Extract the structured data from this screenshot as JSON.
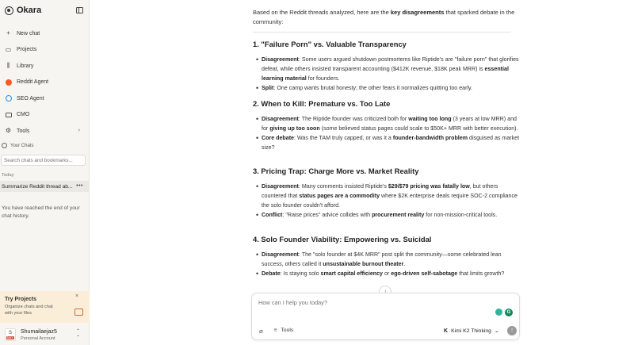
{
  "sidebar": {
    "brand": "Okara",
    "nav": [
      {
        "label": "New chat",
        "icon": "plus-icon"
      },
      {
        "label": "Projects",
        "icon": "folder-icon"
      },
      {
        "label": "Library",
        "icon": "library-icon"
      },
      {
        "label": "Reddit Agent",
        "icon": "reddit-icon"
      },
      {
        "label": "SEO Agent",
        "icon": "globe-icon"
      },
      {
        "label": "CMO",
        "icon": "cmo-icon"
      },
      {
        "label": "Tools",
        "icon": "tools-icon"
      }
    ],
    "your_chats": "Your Chats",
    "search_placeholder": "Search chats and bookmarks...",
    "today": "Today",
    "chat_item": "Summarize Reddit thread ab...",
    "end_note": "You have reached the end of your chat history.",
    "promo": {
      "title": "Try Projects",
      "desc": "Organize chats and chat with your files"
    },
    "user": {
      "initial": "S",
      "badge": "MAX",
      "name": "Shumailaejaz5",
      "sub": "Personal Account"
    }
  },
  "main": {
    "intro_pre": "Based on the Reddit threads analyzed, here are the ",
    "intro_bold": "key disagreements",
    "intro_post": " that sparked debate in the community:",
    "sections": [
      {
        "heading": "1. \"Failure Porn\" vs. Valuable Transparency"
      },
      {
        "heading": "2. When to Kill: Premature vs. Too Late"
      },
      {
        "heading": "3. Pricing Trap: Charge More vs. Market Reality"
      },
      {
        "heading": "4. Solo Founder Viability: Empowering vs. Suicidal"
      }
    ],
    "s1": {
      "b1_label": "Disagreement",
      "b1_a": ": Some users argued shutdown postmortems like Riptide's are \"failure porn\" that glorifies defeat, while others insisted transparent accounting ($412K revenue, $18K peak MRR) is ",
      "b1_bold": "essential learning material",
      "b1_b": " for founders.",
      "b2_label": "Split",
      "b2_a": ": One camp wants brutal honesty; the other fears it normalizes quitting too early."
    },
    "s2": {
      "b1_label": "Disagreement",
      "b1_a": ": The Riptide founder was criticized both for ",
      "b1_bold1": "waiting too long",
      "b1_b": " (3 years at low MRR) and for ",
      "b1_bold2": "giving up too soon",
      "b1_c": " (some believed status pages could scale to $50K+ MRR with better execution).",
      "b2_label": "Core debate",
      "b2_a": ": Was the TAM truly capped, or was it a ",
      "b2_bold": "founder-bandwidth problem",
      "b2_b": " disguised as market size?"
    },
    "s3": {
      "b1_label": "Disagreement",
      "b1_a": ": Many comments insisted Riptide's ",
      "b1_bold1": "$29/$79 pricing was fatally low",
      "b1_b": ", but others countered that ",
      "b1_bold2": "status pages are a commodity",
      "b1_c": " where $2K enterprise deals require SOC-2 compliance the solo founder couldn't afford.",
      "b2_label": "Conflict",
      "b2_a": ": \"Raise prices\" advice collides with ",
      "b2_bold": "procurement reality",
      "b2_b": " for non-mission-critical tools."
    },
    "s4": {
      "b1_label": "Disagreement",
      "b1_a": ": The \"solo founder at $4K MRR\" post split the community—some celebrated lean success, others called it ",
      "b1_bold": "unsustainable burnout theater",
      "b1_b": ".",
      "b2_label": "Debate",
      "b2_a": ": Is staying solo ",
      "b2_bold1": "smart capital efficiency",
      "b2_b": " or ",
      "b2_bold2": "ego-driven self-sabotage",
      "b2_c": " that limits growth?"
    },
    "composer": {
      "placeholder": "How can I help you today?",
      "tools_label": "Tools",
      "model_glyph": "K",
      "model_label": "Kimi K2 Thinking"
    }
  }
}
